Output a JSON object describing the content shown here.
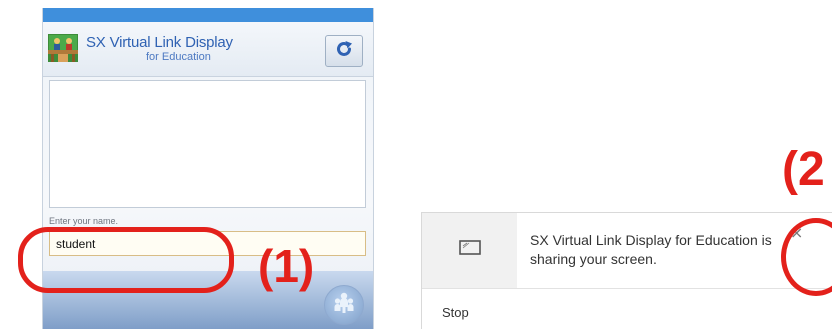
{
  "app": {
    "title_line1": "SX Virtual Link Display",
    "title_line2": "for Education",
    "name_label": "Enter your name.",
    "name_value": "student",
    "icons": {
      "logo": "people-at-desk-logo-icon",
      "refresh": "refresh-icon",
      "connect": "users-connect-icon"
    }
  },
  "notification": {
    "message": "SX Virtual Link Display for Education is sharing your screen.",
    "close_symbol": "×",
    "stop_label": "Stop",
    "icons": {
      "screen": "screen-share-icon",
      "close": "close-icon"
    }
  },
  "callouts": {
    "one": "(1)",
    "two": "(2"
  },
  "colors": {
    "callout_red": "#e3211b",
    "app_title_blue": "#2f62b3",
    "app_topbar": "#3f8fdc"
  }
}
